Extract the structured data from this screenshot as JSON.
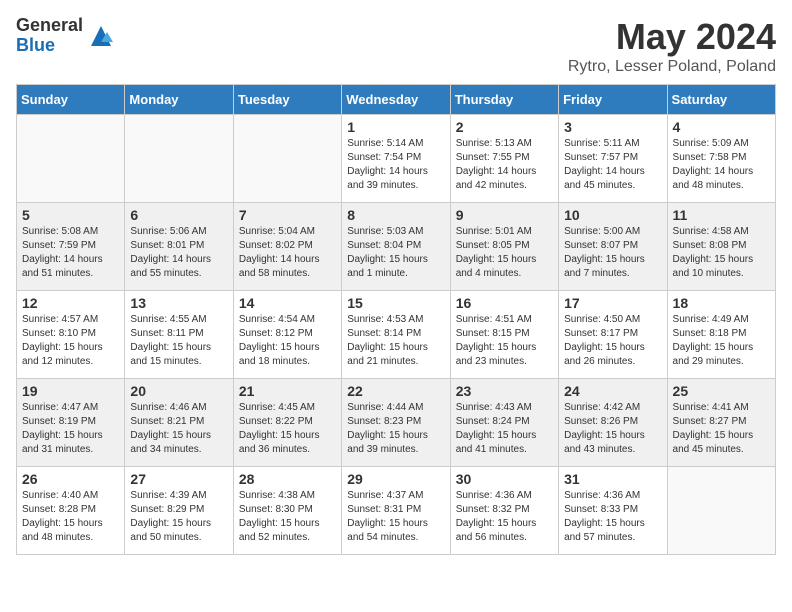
{
  "logo": {
    "general": "General",
    "blue": "Blue"
  },
  "title": "May 2024",
  "location": "Rytro, Lesser Poland, Poland",
  "days_of_week": [
    "Sunday",
    "Monday",
    "Tuesday",
    "Wednesday",
    "Thursday",
    "Friday",
    "Saturday"
  ],
  "weeks": [
    [
      {
        "day": "",
        "sunrise": "",
        "sunset": "",
        "daylight": ""
      },
      {
        "day": "",
        "sunrise": "",
        "sunset": "",
        "daylight": ""
      },
      {
        "day": "",
        "sunrise": "",
        "sunset": "",
        "daylight": ""
      },
      {
        "day": "1",
        "sunrise": "Sunrise: 5:14 AM",
        "sunset": "Sunset: 7:54 PM",
        "daylight": "Daylight: 14 hours and 39 minutes."
      },
      {
        "day": "2",
        "sunrise": "Sunrise: 5:13 AM",
        "sunset": "Sunset: 7:55 PM",
        "daylight": "Daylight: 14 hours and 42 minutes."
      },
      {
        "day": "3",
        "sunrise": "Sunrise: 5:11 AM",
        "sunset": "Sunset: 7:57 PM",
        "daylight": "Daylight: 14 hours and 45 minutes."
      },
      {
        "day": "4",
        "sunrise": "Sunrise: 5:09 AM",
        "sunset": "Sunset: 7:58 PM",
        "daylight": "Daylight: 14 hours and 48 minutes."
      }
    ],
    [
      {
        "day": "5",
        "sunrise": "Sunrise: 5:08 AM",
        "sunset": "Sunset: 7:59 PM",
        "daylight": "Daylight: 14 hours and 51 minutes."
      },
      {
        "day": "6",
        "sunrise": "Sunrise: 5:06 AM",
        "sunset": "Sunset: 8:01 PM",
        "daylight": "Daylight: 14 hours and 55 minutes."
      },
      {
        "day": "7",
        "sunrise": "Sunrise: 5:04 AM",
        "sunset": "Sunset: 8:02 PM",
        "daylight": "Daylight: 14 hours and 58 minutes."
      },
      {
        "day": "8",
        "sunrise": "Sunrise: 5:03 AM",
        "sunset": "Sunset: 8:04 PM",
        "daylight": "Daylight: 15 hours and 1 minute."
      },
      {
        "day": "9",
        "sunrise": "Sunrise: 5:01 AM",
        "sunset": "Sunset: 8:05 PM",
        "daylight": "Daylight: 15 hours and 4 minutes."
      },
      {
        "day": "10",
        "sunrise": "Sunrise: 5:00 AM",
        "sunset": "Sunset: 8:07 PM",
        "daylight": "Daylight: 15 hours and 7 minutes."
      },
      {
        "day": "11",
        "sunrise": "Sunrise: 4:58 AM",
        "sunset": "Sunset: 8:08 PM",
        "daylight": "Daylight: 15 hours and 10 minutes."
      }
    ],
    [
      {
        "day": "12",
        "sunrise": "Sunrise: 4:57 AM",
        "sunset": "Sunset: 8:10 PM",
        "daylight": "Daylight: 15 hours and 12 minutes."
      },
      {
        "day": "13",
        "sunrise": "Sunrise: 4:55 AM",
        "sunset": "Sunset: 8:11 PM",
        "daylight": "Daylight: 15 hours and 15 minutes."
      },
      {
        "day": "14",
        "sunrise": "Sunrise: 4:54 AM",
        "sunset": "Sunset: 8:12 PM",
        "daylight": "Daylight: 15 hours and 18 minutes."
      },
      {
        "day": "15",
        "sunrise": "Sunrise: 4:53 AM",
        "sunset": "Sunset: 8:14 PM",
        "daylight": "Daylight: 15 hours and 21 minutes."
      },
      {
        "day": "16",
        "sunrise": "Sunrise: 4:51 AM",
        "sunset": "Sunset: 8:15 PM",
        "daylight": "Daylight: 15 hours and 23 minutes."
      },
      {
        "day": "17",
        "sunrise": "Sunrise: 4:50 AM",
        "sunset": "Sunset: 8:17 PM",
        "daylight": "Daylight: 15 hours and 26 minutes."
      },
      {
        "day": "18",
        "sunrise": "Sunrise: 4:49 AM",
        "sunset": "Sunset: 8:18 PM",
        "daylight": "Daylight: 15 hours and 29 minutes."
      }
    ],
    [
      {
        "day": "19",
        "sunrise": "Sunrise: 4:47 AM",
        "sunset": "Sunset: 8:19 PM",
        "daylight": "Daylight: 15 hours and 31 minutes."
      },
      {
        "day": "20",
        "sunrise": "Sunrise: 4:46 AM",
        "sunset": "Sunset: 8:21 PM",
        "daylight": "Daylight: 15 hours and 34 minutes."
      },
      {
        "day": "21",
        "sunrise": "Sunrise: 4:45 AM",
        "sunset": "Sunset: 8:22 PM",
        "daylight": "Daylight: 15 hours and 36 minutes."
      },
      {
        "day": "22",
        "sunrise": "Sunrise: 4:44 AM",
        "sunset": "Sunset: 8:23 PM",
        "daylight": "Daylight: 15 hours and 39 minutes."
      },
      {
        "day": "23",
        "sunrise": "Sunrise: 4:43 AM",
        "sunset": "Sunset: 8:24 PM",
        "daylight": "Daylight: 15 hours and 41 minutes."
      },
      {
        "day": "24",
        "sunrise": "Sunrise: 4:42 AM",
        "sunset": "Sunset: 8:26 PM",
        "daylight": "Daylight: 15 hours and 43 minutes."
      },
      {
        "day": "25",
        "sunrise": "Sunrise: 4:41 AM",
        "sunset": "Sunset: 8:27 PM",
        "daylight": "Daylight: 15 hours and 45 minutes."
      }
    ],
    [
      {
        "day": "26",
        "sunrise": "Sunrise: 4:40 AM",
        "sunset": "Sunset: 8:28 PM",
        "daylight": "Daylight: 15 hours and 48 minutes."
      },
      {
        "day": "27",
        "sunrise": "Sunrise: 4:39 AM",
        "sunset": "Sunset: 8:29 PM",
        "daylight": "Daylight: 15 hours and 50 minutes."
      },
      {
        "day": "28",
        "sunrise": "Sunrise: 4:38 AM",
        "sunset": "Sunset: 8:30 PM",
        "daylight": "Daylight: 15 hours and 52 minutes."
      },
      {
        "day": "29",
        "sunrise": "Sunrise: 4:37 AM",
        "sunset": "Sunset: 8:31 PM",
        "daylight": "Daylight: 15 hours and 54 minutes."
      },
      {
        "day": "30",
        "sunrise": "Sunrise: 4:36 AM",
        "sunset": "Sunset: 8:32 PM",
        "daylight": "Daylight: 15 hours and 56 minutes."
      },
      {
        "day": "31",
        "sunrise": "Sunrise: 4:36 AM",
        "sunset": "Sunset: 8:33 PM",
        "daylight": "Daylight: 15 hours and 57 minutes."
      },
      {
        "day": "",
        "sunrise": "",
        "sunset": "",
        "daylight": ""
      }
    ]
  ]
}
